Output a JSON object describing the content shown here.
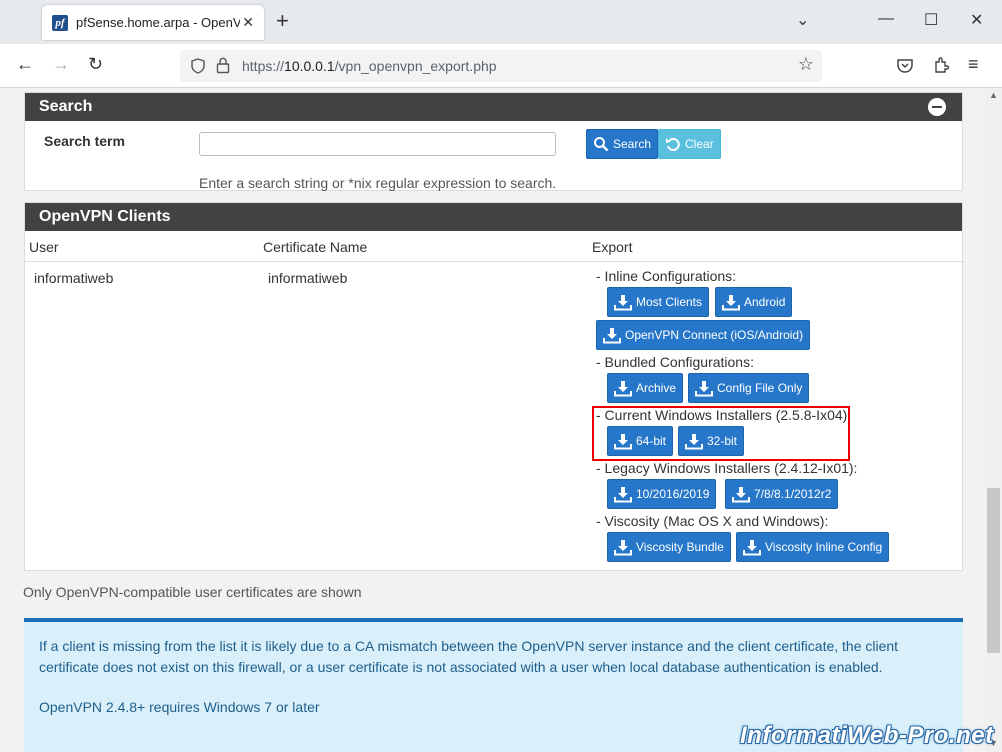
{
  "browser": {
    "tab_title": "pfSense.home.arpa - OpenVPN",
    "favicon_text": "pf",
    "url_scheme": "https://",
    "url_host": "10.0.0.1",
    "url_path": "/vpn_openvpn_export.php"
  },
  "search_panel": {
    "title": "Search",
    "term_label": "Search term",
    "input_value": "",
    "search_button": "Search",
    "clear_button": "Clear",
    "help_text": "Enter a search string or *nix regular expression to search."
  },
  "clients_panel": {
    "title": "OpenVPN Clients",
    "columns": [
      "User",
      "Certificate Name",
      "Export"
    ],
    "row": {
      "user": "informatiweb",
      "certificate": "informatiweb"
    },
    "sections": {
      "inline": {
        "label": "- Inline Configurations:",
        "buttons": [
          "Most Clients",
          "Android",
          "OpenVPN Connect (iOS/Android)"
        ]
      },
      "bundled": {
        "label": "- Bundled Configurations:",
        "buttons": [
          "Archive",
          "Config File Only"
        ]
      },
      "current_windows": {
        "label": "- Current Windows Installers (2.5.8-Ix04):",
        "buttons": [
          "64-bit",
          "32-bit"
        ]
      },
      "legacy_windows": {
        "label": "- Legacy Windows Installers (2.4.12-Ix01):",
        "buttons": [
          "10/2016/2019",
          "7/8/8.1/2012r2"
        ]
      },
      "viscosity": {
        "label": "- Viscosity (Mac OS X and Windows):",
        "buttons": [
          "Viscosity Bundle",
          "Viscosity Inline Config"
        ]
      }
    }
  },
  "footnote": "Only OpenVPN-compatible user certificates are shown",
  "info": {
    "p1": "If a client is missing from the list it is likely due to a CA mismatch between the OpenVPN server instance and the client certificate, the client certificate does not exist on this firewall, or a user certificate is not associated with a user when local database authentication is enabled.",
    "p2": "OpenVPN 2.4.8+ requires Windows 7 or later"
  },
  "watermark": "InformatiWeb-Pro.net",
  "colors": {
    "panel_header": "#424242",
    "primary_button": "#2677c9",
    "info_button": "#5bc0de",
    "info_box_bg": "#d9f0fa",
    "highlight": "#ee0000"
  }
}
